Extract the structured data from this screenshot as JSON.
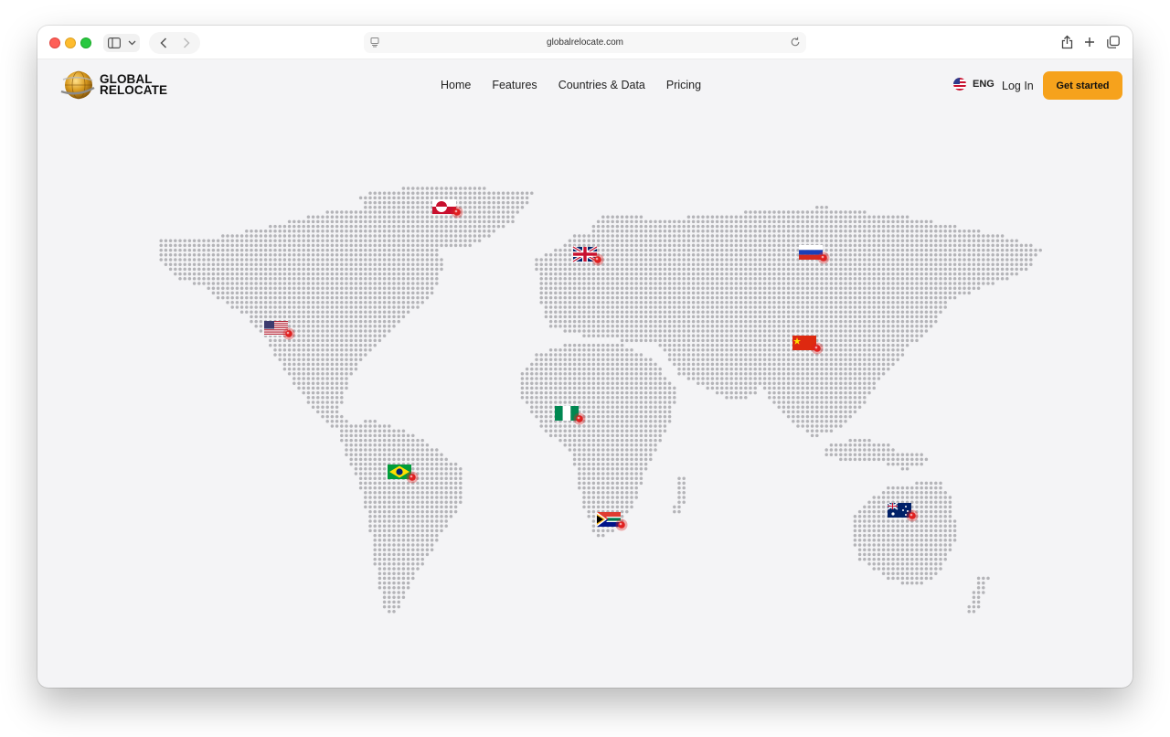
{
  "browser": {
    "url": "globalrelocate.com",
    "icons": {
      "sidebar": "sidebar-icon",
      "chevron": "chevron-down-icon",
      "back": "chevron-left-icon",
      "forward": "chevron-right-icon",
      "page": "page-icon",
      "reload": "reload-icon",
      "share": "share-icon",
      "new_tab": "plus-icon",
      "tabs": "tabs-overview-icon"
    }
  },
  "site": {
    "logo_line1": "GLOBAL",
    "logo_line2": "RELOCATE",
    "nav": [
      "Home",
      "Features",
      "Countries & Data",
      "Pricing"
    ],
    "language": "ENG",
    "login_label": "Log In",
    "cta_label": "Get started",
    "accent_color": "#f6a21c"
  },
  "map": {
    "markers": [
      {
        "country": "Greenland",
        "flag": "greenland-flag-icon"
      },
      {
        "country": "United Kingdom",
        "flag": "uk-flag-icon"
      },
      {
        "country": "Russia",
        "flag": "russia-flag-icon"
      },
      {
        "country": "United States",
        "flag": "usa-flag-icon"
      },
      {
        "country": "China",
        "flag": "china-flag-icon"
      },
      {
        "country": "Nigeria",
        "flag": "nigeria-flag-icon"
      },
      {
        "country": "Brazil",
        "flag": "brazil-flag-icon"
      },
      {
        "country": "South Africa",
        "flag": "south-africa-flag-icon"
      },
      {
        "country": "Australia",
        "flag": "australia-flag-icon"
      }
    ],
    "marker_color": "#e02020",
    "dot_color": "#b4b4b8"
  }
}
